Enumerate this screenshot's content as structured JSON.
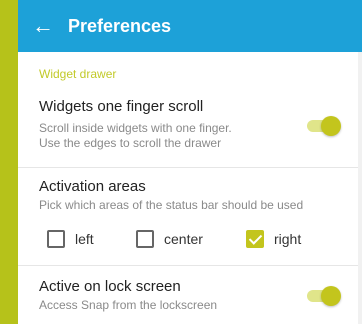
{
  "appbar": {
    "back_icon": "arrow-left-icon",
    "title": "Preferences"
  },
  "section": {
    "title": "Widget drawer"
  },
  "widgets_scroll": {
    "title": "Widgets one finger scroll",
    "subtitle_line1": "Scroll inside widgets with one finger.",
    "subtitle_line2": "Use the edges to scroll the drawer",
    "enabled": true
  },
  "activation_areas": {
    "title": "Activation areas",
    "subtitle": "Pick which areas of the status bar should be used",
    "options": [
      {
        "label": "left",
        "checked": false
      },
      {
        "label": "center",
        "checked": false
      },
      {
        "label": "right",
        "checked": true
      }
    ]
  },
  "lock_screen": {
    "title": "Active on lock screen",
    "subtitle": "Access Snap from the lockscreen",
    "enabled": true
  },
  "colors": {
    "appbar": "#1da1d8",
    "accent": "#c3c51d",
    "frame": "#b6c21a"
  }
}
